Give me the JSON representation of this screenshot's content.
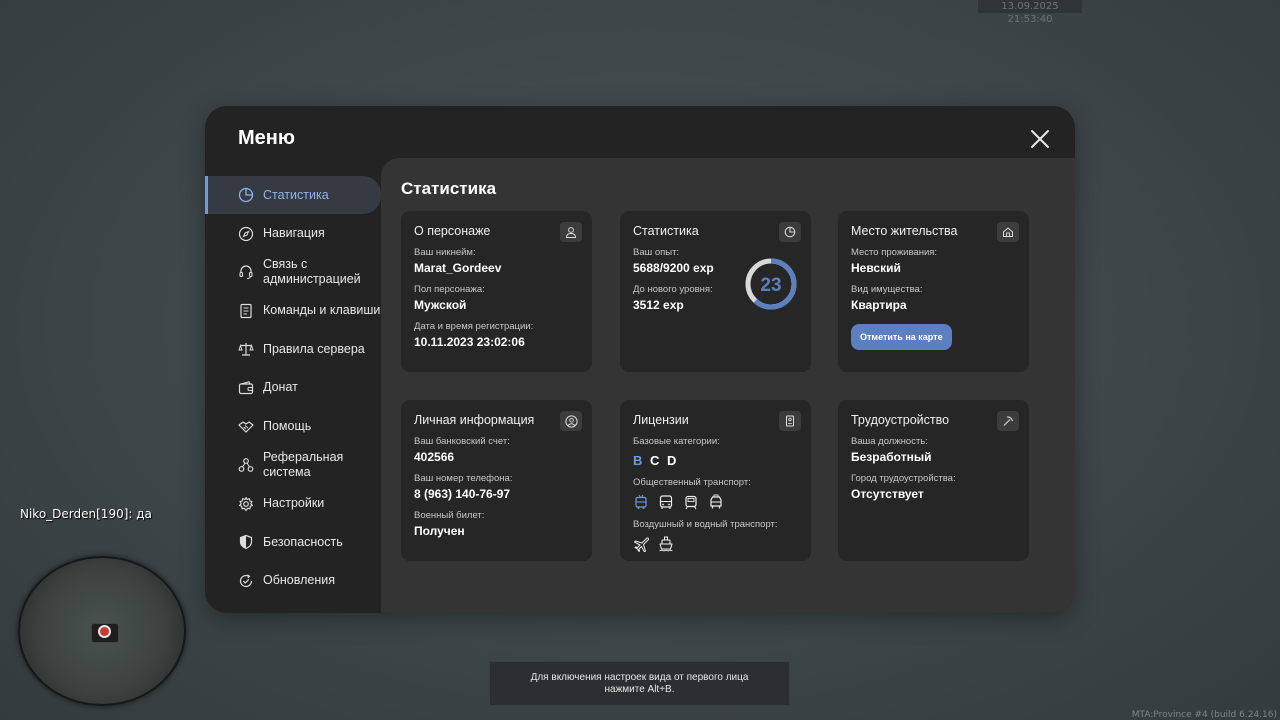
{
  "hud": {
    "timestamp": "13.09.2025 21:53:40",
    "chat_line": "Niko_Derden[190]: да",
    "hint": "Для включения настроек вида от первого лица нажмите Alt+B.",
    "build": "MTA:Province #4 (build 6.24.16)"
  },
  "menu": {
    "title": "Меню",
    "sidebar": [
      {
        "label": "Статистика",
        "icon": "pie-chart-icon",
        "active": true
      },
      {
        "label": "Навигация",
        "icon": "compass-icon"
      },
      {
        "label": "Связь с администрацией",
        "icon": "headset-icon"
      },
      {
        "label": "Команды и клавиши",
        "icon": "document-icon"
      },
      {
        "label": "Правила сервера",
        "icon": "scales-icon"
      },
      {
        "label": "Донат",
        "icon": "wallet-icon"
      },
      {
        "label": "Помощь",
        "icon": "handshake-icon"
      },
      {
        "label": "Реферальная система",
        "icon": "network-icon"
      },
      {
        "label": "Настройки",
        "icon": "gear-icon"
      },
      {
        "label": "Безопасность",
        "icon": "shield-icon"
      },
      {
        "label": "Обновления",
        "icon": "refresh-check-icon"
      }
    ]
  },
  "content": {
    "title": "Статистика",
    "character": {
      "title": "О персонаже",
      "nick_label": "Ваш никнейм:",
      "nick": "Marat_Gordeev",
      "gender_label": "Пол персонажа:",
      "gender": "Мужской",
      "reg_label": "Дата и время регистрации:",
      "reg": "10.11.2023 23:02:06"
    },
    "stats": {
      "title": "Статистика",
      "exp_label": "Ваш опыт:",
      "exp": "5688/9200 exp",
      "next_label": "До нового уровня:",
      "next": "3512 exp",
      "level": "23",
      "progress": 0.618
    },
    "residence": {
      "title": "Место жительства",
      "place_label": "Место проживания:",
      "place": "Невский",
      "prop_label": "Вид имущества:",
      "prop": "Квартира",
      "button": "Отметить на карте"
    },
    "personal": {
      "title": "Личная информация",
      "bank_label": "Ваш банковский счет:",
      "bank": "402566",
      "phone_label": "Ваш номер телефона:",
      "phone": "8 (963) 140-76-97",
      "military_label": "Военный билет:",
      "military": "Получен"
    },
    "licenses": {
      "title": "Лицензии",
      "base_label": "Базовые категории:",
      "cats": [
        "B",
        "C",
        "D"
      ],
      "public_label": "Общественный транспорт:",
      "public_icons": [
        "trolleybus-icon",
        "bus-icon",
        "tram-icon",
        "taxi-icon"
      ],
      "air_label": "Воздушный и водный транспорт:",
      "air_icons": [
        "plane-icon",
        "ship-icon"
      ]
    },
    "job": {
      "title": "Трудоустройство",
      "pos_label": "Ваша должность:",
      "pos": "Безработный",
      "city_label": "Город трудоустройства:",
      "city": "Отсутствует"
    }
  },
  "colors": {
    "accent": "#6e9be0",
    "button": "#5b7fc0",
    "card": "#262626",
    "panel": "#343434"
  }
}
